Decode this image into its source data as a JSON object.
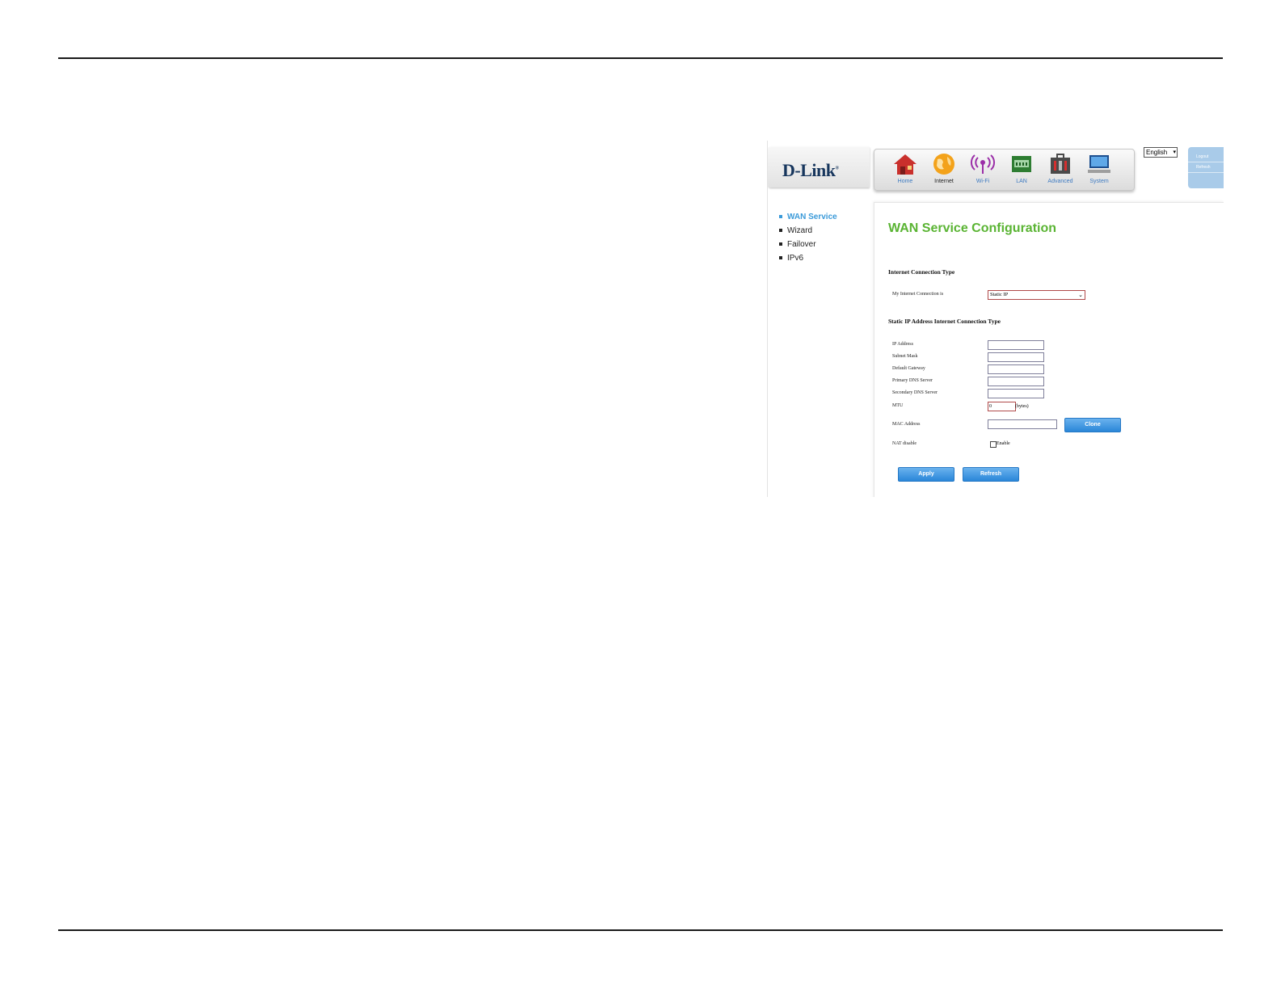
{
  "brand": {
    "logo_text": "D-Link",
    "logo_mark": "®"
  },
  "nav": [
    {
      "label": "Home",
      "icon": "home-icon"
    },
    {
      "label": "Internet",
      "icon": "globe-icon",
      "active": true
    },
    {
      "label": "Wi-Fi",
      "icon": "wifi-icon"
    },
    {
      "label": "LAN",
      "icon": "lan-icon"
    },
    {
      "label": "Advanced",
      "icon": "toolbox-icon"
    },
    {
      "label": "System",
      "icon": "monitor-icon"
    }
  ],
  "language": {
    "selected": "English"
  },
  "utility": {
    "logout": "Logout",
    "refresh": "Refresh"
  },
  "sidebar": [
    {
      "label": "WAN Service",
      "active": true
    },
    {
      "label": "Wizard"
    },
    {
      "label": "Failover"
    },
    {
      "label": "IPv6"
    }
  ],
  "page": {
    "title": "WAN Service Configuration",
    "section1": "Internet Connection Type",
    "connection_label": "My Internet Connection is",
    "connection_value": "Static IP",
    "section2": "Static IP Address Internet Connection Type",
    "fields": [
      {
        "label": "IP Address",
        "value": ""
      },
      {
        "label": "Subnet Mask",
        "value": ""
      },
      {
        "label": "Default Gateway",
        "value": ""
      },
      {
        "label": "Primary DNS Server",
        "value": ""
      },
      {
        "label": "Secondary DNS Server",
        "value": ""
      }
    ],
    "mtu_label": "MTU",
    "mtu_value": "0",
    "mtu_unit": "(bytes)",
    "mac_label": "MAC Address",
    "mac_value": "",
    "clone_button": "Clone",
    "nat_label": "NAT disable",
    "nat_checkbox_label": "Enable",
    "nat_checked": false,
    "apply_button": "Apply",
    "refresh_button": "Refresh"
  },
  "colors": {
    "title_green": "#5ab433",
    "link_blue": "#3a9ad9",
    "button_blue": "#2a86d8"
  }
}
